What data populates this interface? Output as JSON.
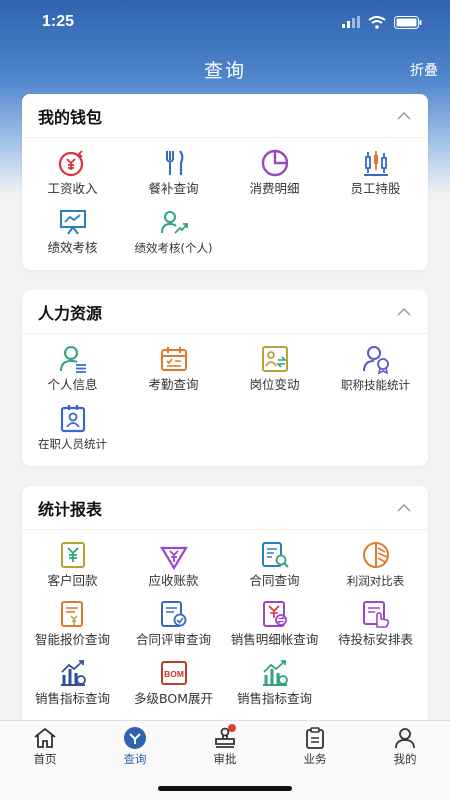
{
  "status_bar": {
    "time": "1:25"
  },
  "header": {
    "title": "查询",
    "fold": "折叠"
  },
  "sections": [
    {
      "title": "我的钱包",
      "items": [
        {
          "label": "工资收入",
          "icon": "salary-icon"
        },
        {
          "label": "餐补查询",
          "icon": "cutlery-icon"
        },
        {
          "label": "消费明细",
          "icon": "pie-chart-icon"
        },
        {
          "label": "员工持股",
          "icon": "candlestick-icon"
        },
        {
          "label": "绩效考核",
          "icon": "presentation-board-icon"
        },
        {
          "label": "绩效考核(个人)",
          "icon": "person-trend-icon"
        }
      ]
    },
    {
      "title": "人力资源",
      "items": [
        {
          "label": "个人信息",
          "icon": "person-info-icon"
        },
        {
          "label": "考勤查询",
          "icon": "calendar-icon"
        },
        {
          "label": "岗位变动",
          "icon": "position-change-icon"
        },
        {
          "label": "职称技能统计",
          "icon": "person-award-icon"
        },
        {
          "label": "在职人员统计",
          "icon": "badge-id-icon"
        }
      ]
    },
    {
      "title": "统计报表",
      "items": [
        {
          "label": "客户回款",
          "icon": "yen-document-icon"
        },
        {
          "label": "应收账款",
          "icon": "yen-download-icon"
        },
        {
          "label": "合同查询",
          "icon": "contract-search-icon"
        },
        {
          "label": "利润对比表",
          "icon": "profit-compare-icon"
        },
        {
          "label": "智能报价查询",
          "icon": "quote-document-icon"
        },
        {
          "label": "合同评审查询",
          "icon": "contract-review-icon"
        },
        {
          "label": "销售明细帐查询",
          "icon": "sales-detail-icon"
        },
        {
          "label": "待投标安排表",
          "icon": "bid-hand-icon"
        },
        {
          "label": "销售指标查询",
          "icon": "sales-index-icon"
        },
        {
          "label": "多级BOM展开",
          "icon": "bom-icon"
        },
        {
          "label": "销售指标查询",
          "icon": "sales-index-green-icon"
        }
      ]
    }
  ],
  "tabbar": [
    {
      "label": "首页",
      "icon": "home-icon"
    },
    {
      "label": "查询",
      "icon": "query-icon",
      "active": true
    },
    {
      "label": "审批",
      "icon": "stamp-icon",
      "badge": true
    },
    {
      "label": "业务",
      "icon": "clipboard-icon"
    },
    {
      "label": "我的",
      "icon": "user-icon"
    }
  ],
  "colors": {
    "header": "#2f63b0",
    "accent": "#2f63b0",
    "red": "#d9333f",
    "blue": "#3a68c7",
    "purple": "#9b45c9",
    "green": "#31a37a",
    "orange": "#e07a2c",
    "olive": "#b4a238",
    "badge": "#e23b3b"
  }
}
